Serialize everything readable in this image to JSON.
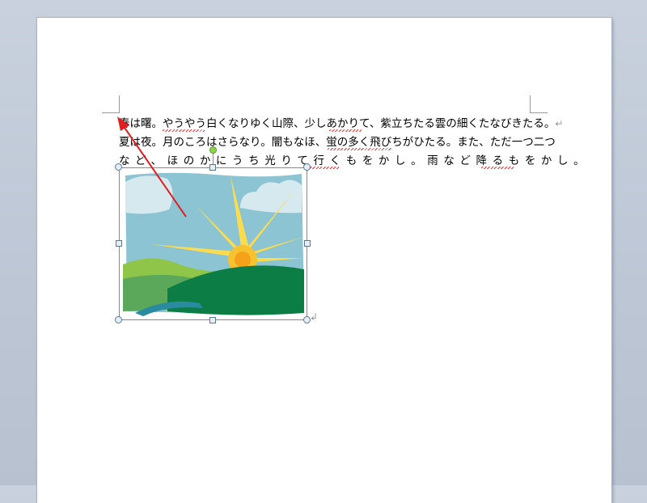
{
  "document": {
    "lines": [
      "春は曙。やうやう白くなりゆく山際、少しあかりて、紫立ちたる雲の細くたなびきたる。",
      "夏は夜。月のころはさらなり。闇もなほ、蛍の多く飛びちがひたる。また、ただ一つ二つ",
      "など、ほのかにうち光りて行くもをかし。雨など降るもをかし。"
    ],
    "paragraph_mark": "↵",
    "image_return_mark": "↲"
  },
  "image": {
    "description_icon": "sunrise-landscape-clipart",
    "colors": {
      "sky": "#8cc4d3",
      "cloud": "#d6e9ef",
      "sun": "#f7c230",
      "rays": "#fbdc4e",
      "hill_dark": "#0b7d45",
      "hill_mid": "#5ca85a",
      "hill_light": "#8fc64a",
      "river": "#2a8aa0"
    }
  },
  "annotation": {
    "arrow_color": "#e02020"
  }
}
